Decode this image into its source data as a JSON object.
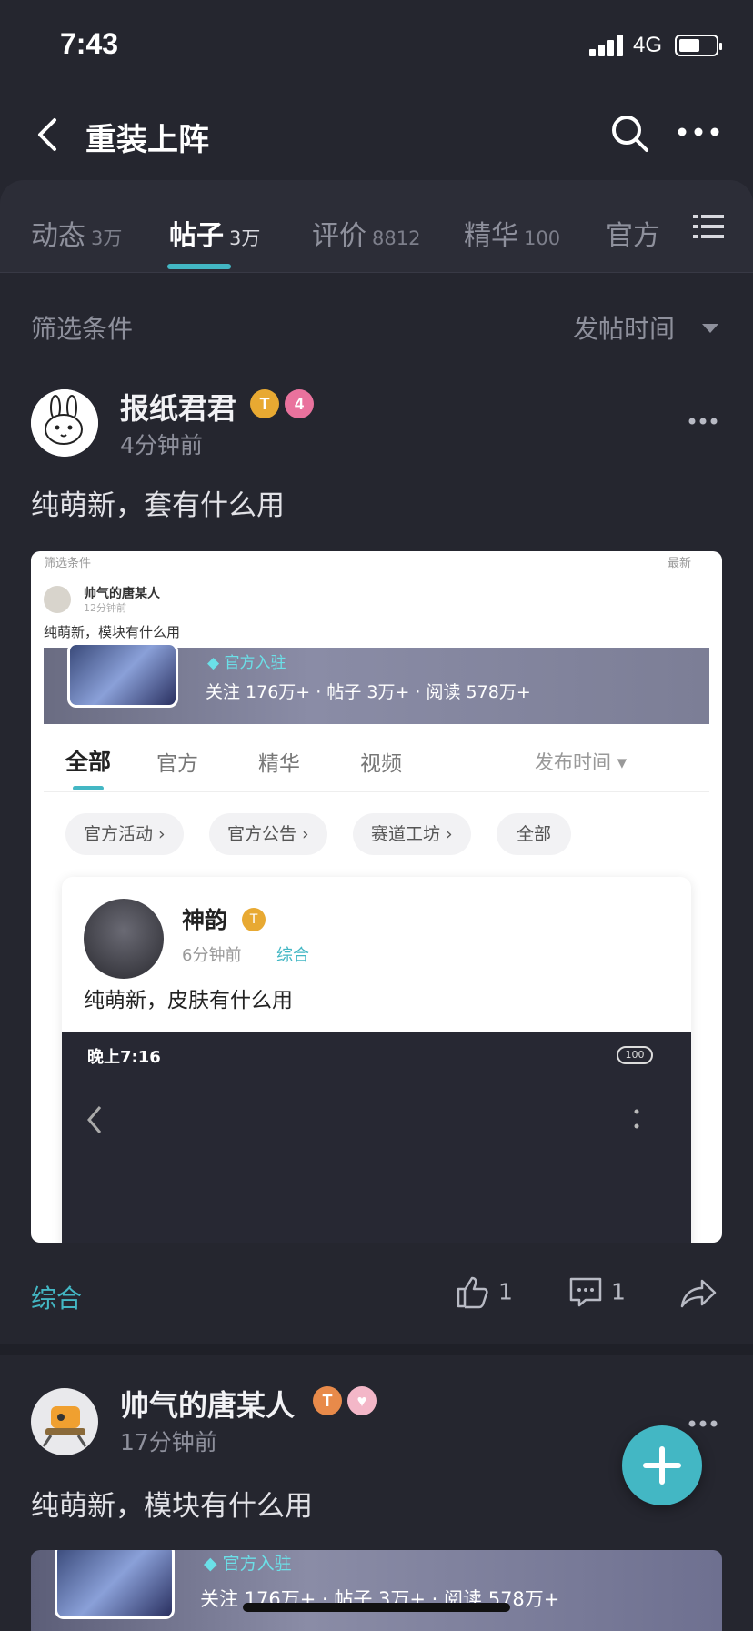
{
  "status": {
    "time": "7:43",
    "network": "4G"
  },
  "nav": {
    "title": "重装上阵"
  },
  "tabs": [
    {
      "label": "动态",
      "count": "3万"
    },
    {
      "label": "帖子",
      "count": "3万"
    },
    {
      "label": "评价",
      "count": "8812"
    },
    {
      "label": "精华",
      "count": "100"
    },
    {
      "label": "官方",
      "count": ""
    }
  ],
  "filter": {
    "label": "筛选条件",
    "sort": "发帖时间"
  },
  "posts": [
    {
      "author": "报纸君君",
      "level_badge": "4",
      "time": "4分钟前",
      "text": "纯萌新，套有什么用",
      "tag": "综合",
      "likes": "1",
      "comments": "1",
      "screenshot": {
        "filter": "筛选条件",
        "sort": "最新",
        "inner_author": "帅气的唐某人",
        "inner_time": "12分钟前",
        "inner_text": "纯萌新，模块有什么用",
        "official_badge": "官方入驻",
        "stats": "关注 176万+ · 帖子 3万+ · 阅读 578万+",
        "tabs": [
          "全部",
          "官方",
          "精华",
          "视频"
        ],
        "sort2": "发布时间",
        "chips": [
          "官方活动",
          "官方公告",
          "赛道工坊",
          "全部"
        ],
        "card_author": "神韵",
        "card_time": "6分钟前",
        "card_tag": "综合",
        "card_text": "纯萌新，皮肤有什么用",
        "phone_time": "晚上7:16",
        "battery": "100"
      }
    },
    {
      "author": "帅气的唐某人",
      "time": "17分钟前",
      "text": "纯萌新，模块有什么用",
      "preview": {
        "official_badge": "官方入驻",
        "stats": "关注 176万+ · 帖子 3万+ · 阅读 578万+"
      }
    }
  ]
}
